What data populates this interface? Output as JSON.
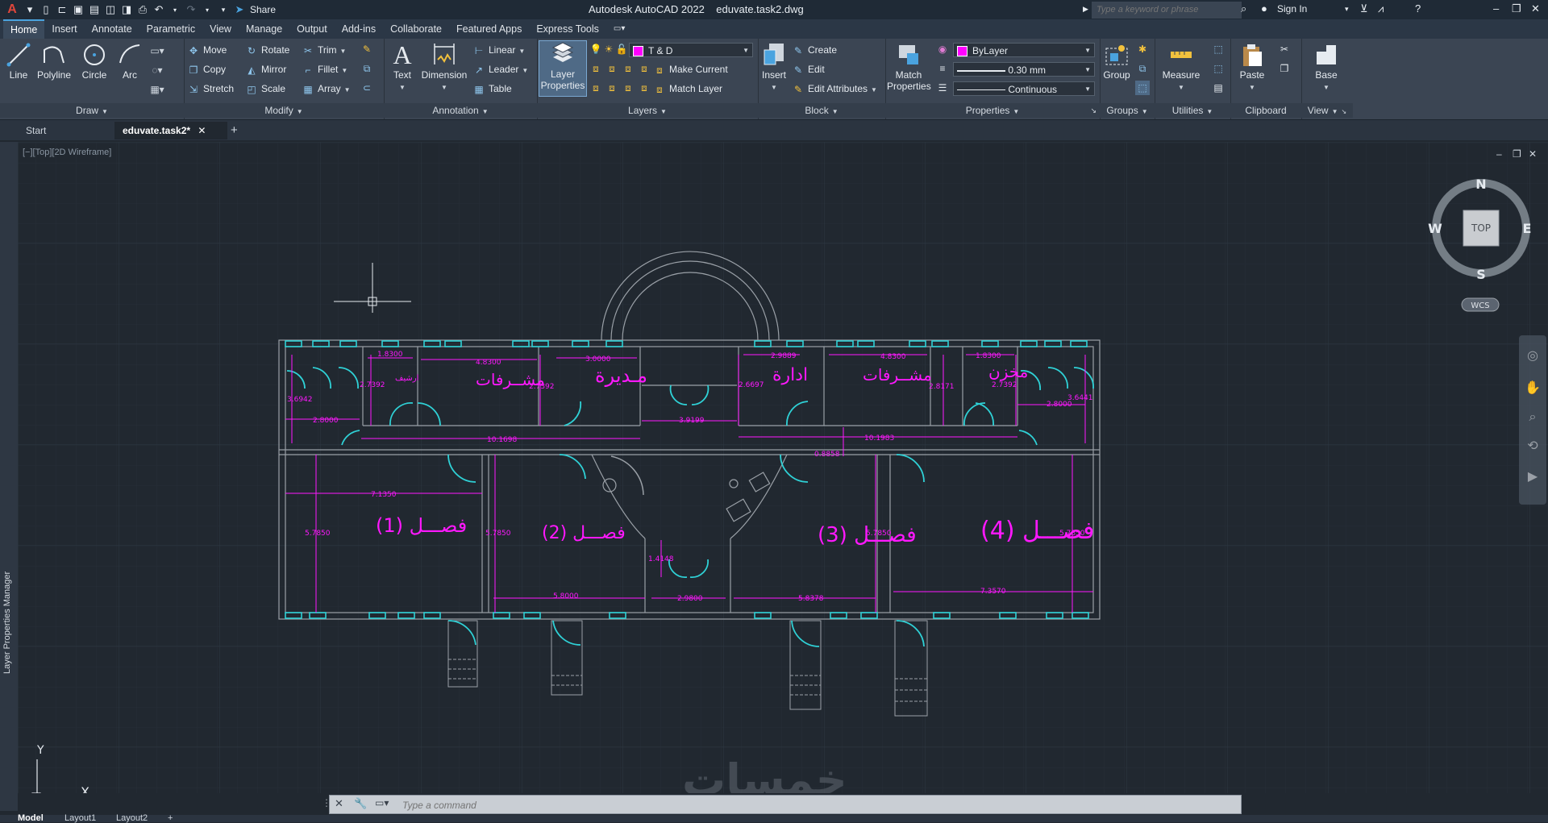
{
  "titlebar": {
    "app_title": "Autodesk AutoCAD 2022",
    "file_name": "eduvate.task2.dwg",
    "share_label": "Share",
    "search_placeholder": "Type a keyword or phrase",
    "sign_in_label": "Sign In"
  },
  "ribbon_tabs": [
    "Home",
    "Insert",
    "Annotate",
    "Parametric",
    "View",
    "Manage",
    "Output",
    "Add-ins",
    "Collaborate",
    "Featured Apps",
    "Express Tools"
  ],
  "ribbon": {
    "draw": {
      "title": "Draw",
      "line": "Line",
      "polyline": "Polyline",
      "circle": "Circle",
      "arc": "Arc"
    },
    "modify": {
      "title": "Modify",
      "move": "Move",
      "rotate": "Rotate",
      "trim": "Trim",
      "copy": "Copy",
      "mirror": "Mirror",
      "fillet": "Fillet",
      "stretch": "Stretch",
      "scale": "Scale",
      "array": "Array"
    },
    "annotation": {
      "title": "Annotation",
      "text": "Text",
      "dimension": "Dimension",
      "linear": "Linear",
      "leader": "Leader",
      "table": "Table"
    },
    "layers": {
      "title": "Layers",
      "layer_properties_line1": "Layer",
      "layer_properties_line2": "Properties",
      "current_layer": "T & D",
      "make_current": "Make Current",
      "match_layer": "Match Layer"
    },
    "block": {
      "title": "Block",
      "insert": "Insert",
      "create": "Create",
      "edit": "Edit",
      "edit_attributes": "Edit Attributes"
    },
    "properties": {
      "title": "Properties",
      "match_line1": "Match",
      "match_line2": "Properties",
      "color": "ByLayer",
      "lineweight": "0.30 mm",
      "linetype": "Continuous"
    },
    "groups": {
      "title": "Groups",
      "group": "Group"
    },
    "utilities": {
      "title": "Utilities",
      "measure": "Measure"
    },
    "clipboard": {
      "title": "Clipboard",
      "paste": "Paste"
    },
    "view": {
      "title": "View",
      "base": "Base"
    }
  },
  "file_tabs": {
    "start": "Start",
    "active": "eduvate.task2*"
  },
  "left_panel_label": "Layer Properties Manager",
  "viewport_label": "[−][Top][2D Wireframe]",
  "viewcube": {
    "n": "N",
    "s": "S",
    "e": "E",
    "w": "W",
    "face": "TOP",
    "wcs": "WCS"
  },
  "ucs": {
    "x": "X",
    "y": "Y"
  },
  "drawing": {
    "rooms": {
      "class1": "فصـــل (1)",
      "class2": "فصـــل (2)",
      "class3": "فصـــل (3)",
      "class4": "فصـــل (4)",
      "supervisors_left": "مشــرفات",
      "supervisors_right": "مشــرفات",
      "principal": "مـديرة",
      "admin": "ادارة",
      "store": "مخزن",
      "archive": "ارشيف"
    },
    "dims": {
      "d1": "1.8300",
      "d2": "4.8300",
      "d3": "3.0000",
      "d4": "2.9889",
      "d5": "4.8300",
      "d6": "1.8300",
      "d7": "3.6942",
      "d8": "2.7392",
      "d9": "2.7392",
      "d10": "2.6697",
      "d11": "2.8171",
      "d12": "2.7392",
      "d13": "3.6441",
      "d14": "2.8000",
      "d15": "2.8000",
      "d16": "10.1698",
      "d17": "3.9199",
      "d18": "10.1983",
      "d19": "0.8858",
      "d20": "7.1350",
      "d21": "5.7850",
      "d22": "5.7850",
      "d23": "5.7850",
      "d24": "5.7850",
      "d25": "1.4148",
      "d26": "5.8000",
      "d27": "2.9800",
      "d28": "5.8378",
      "d29": "7.3570"
    }
  },
  "watermark": "خمسات",
  "command": {
    "placeholder": "Type a command"
  },
  "status_tabs": [
    "Model",
    "Layout1",
    "Layout2"
  ]
}
